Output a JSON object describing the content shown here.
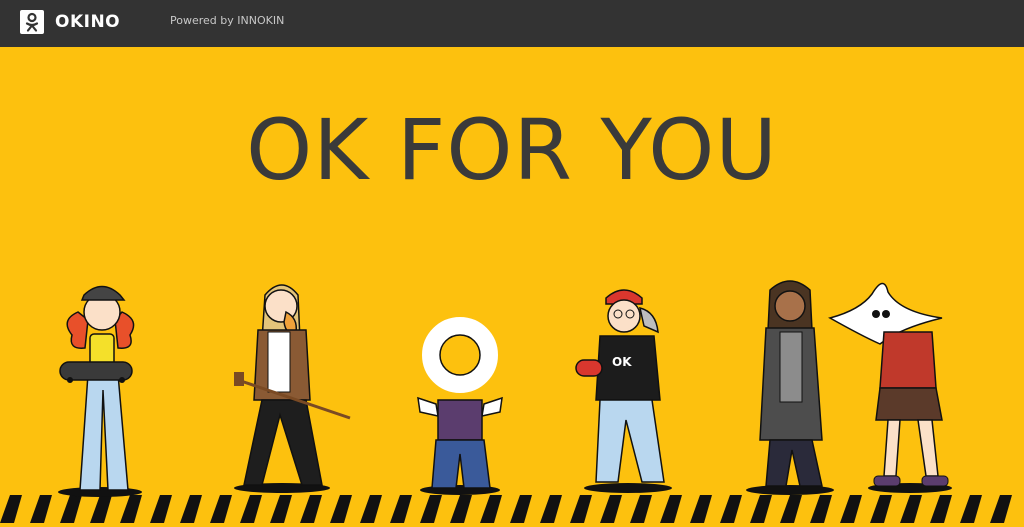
{
  "header": {
    "logo_label": "OKINO",
    "powered_by": "Powered by INNOKIN"
  },
  "hero": {
    "headline": "OK FOR YOU",
    "chest_label": "OK"
  },
  "colors": {
    "background": "#fdc10e",
    "topbar": "#333333",
    "headline": "#3a3a3a"
  }
}
